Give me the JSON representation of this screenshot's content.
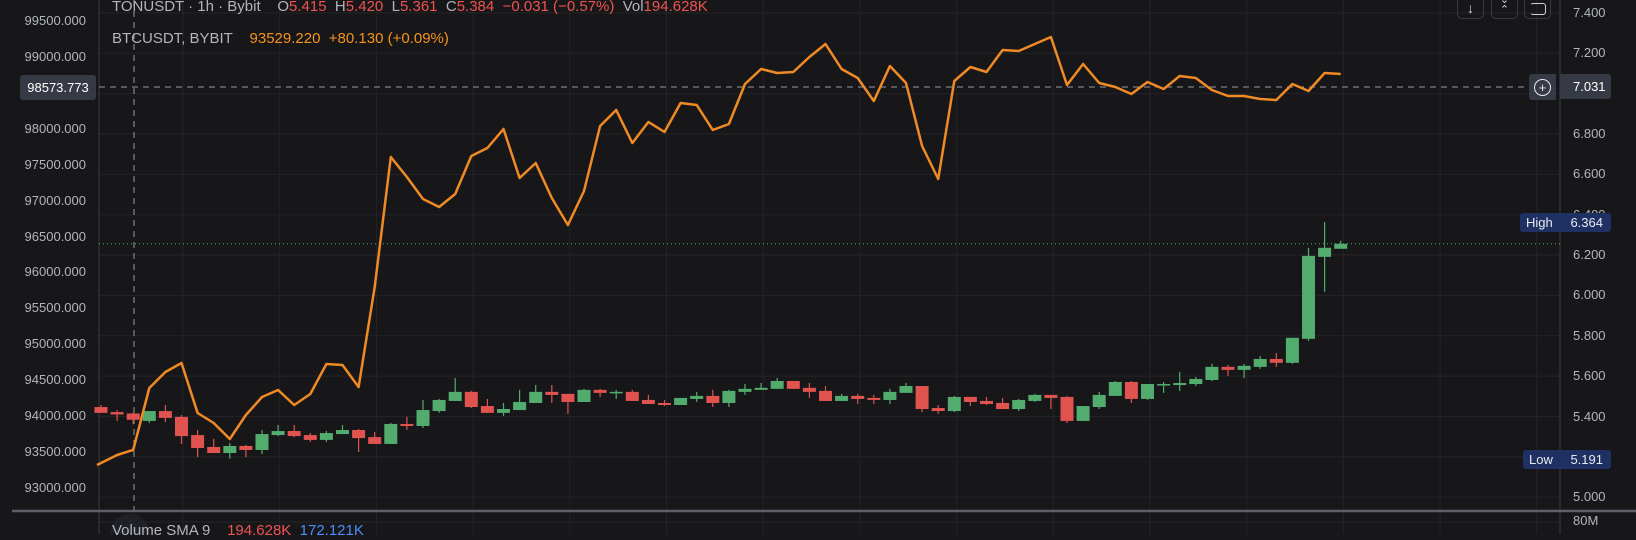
{
  "header": {
    "symbol": "TONUSDT · 1h · Bybit",
    "o_label": "O",
    "o_value": "5.415",
    "h_label": "H",
    "h_value": "5.420",
    "l_label": "L",
    "l_value": "5.361",
    "c_label": "C",
    "c_value": "5.384",
    "change": "−0.031 (−0.57%)",
    "vol_label": "Vol",
    "vol_value": "194.628K",
    "compare_symbol": "BTCUSDT, BYBIT",
    "compare_value": "93529.220",
    "compare_change": "+80.130 (+0.09%)"
  },
  "volume_pane": {
    "label": "Volume SMA 9",
    "volume": "194.628K",
    "sma": "172.121K",
    "axis_label": "80M"
  },
  "crosshair": {
    "left_price": "98573.773",
    "right_price": "7.031"
  },
  "high_marker": {
    "label": "High",
    "value": "6.364"
  },
  "low_marker": {
    "label": "Low",
    "value": "5.191"
  },
  "colors": {
    "up": "#52ac6e",
    "down": "#e0534f",
    "line": "#f08a24",
    "grid": "#242428",
    "bg": "#17171a"
  },
  "toolbar": {
    "icons": [
      "arrow-down-icon",
      "collapse-icon",
      "maximize-icon"
    ]
  },
  "chart_data": {
    "type": "line+candlestick",
    "title": "TONUSDT · 1h · Bybit vs BTCUSDT, BYBIT",
    "left_axis": {
      "series": "BTCUSDT",
      "ticks": [
        "99500.000",
        "99000.000",
        "98000.000",
        "97500.000",
        "97000.000",
        "96500.000",
        "96000.000",
        "95500.000",
        "95000.000",
        "94500.000",
        "94000.000",
        "93500.000",
        "93000.000"
      ],
      "tick_values": [
        99500,
        99000,
        98000,
        97500,
        97000,
        96500,
        96000,
        95500,
        95000,
        94500,
        94000,
        93500,
        93000
      ],
      "range": [
        92820,
        99800
      ]
    },
    "right_axis": {
      "series": "TONUSDT",
      "ticks": [
        "7.400",
        "7.200",
        "6.800",
        "6.600",
        "6.400",
        "6.200",
        "6.000",
        "5.800",
        "5.600",
        "5.400",
        "5.000"
      ],
      "tick_values": [
        7.4,
        7.2,
        6.8,
        6.6,
        6.4,
        6.2,
        6.0,
        5.8,
        5.6,
        5.4,
        5.0
      ],
      "grid_values": [
        7.4,
        7.2,
        7.0,
        6.8,
        6.6,
        6.4,
        6.2,
        6.0,
        5.8,
        5.6,
        5.4,
        5.2,
        5.0
      ],
      "range": [
        4.93,
        7.46
      ]
    },
    "grid": true,
    "last_price": 6.256,
    "btc_line": [
      93320,
      93459,
      93529.22,
      94391,
      94614,
      94739,
      94043,
      93904,
      93681,
      94016,
      94266,
      94364,
      94155,
      94308,
      94725,
      94712,
      94405,
      95797,
      97607,
      97328,
      97022,
      96911,
      97092,
      97621,
      97732,
      97997,
      97315,
      97523,
      97036,
      96660,
      97134,
      98038,
      98261,
      97802,
      98094,
      97955,
      98359,
      98331,
      97983,
      98066,
      98623,
      98832,
      98776,
      98790,
      98999,
      99180,
      98832,
      98707,
      98386,
      98874,
      98637,
      97760,
      97301,
      98665,
      98860,
      98790,
      99096,
      99082,
      99180,
      99277,
      98609,
      98901,
      98637,
      98581,
      98484,
      98651,
      98553,
      98734,
      98707,
      98540,
      98456,
      98456,
      98414,
      98400,
      98623,
      98526,
      98776,
      98762
    ],
    "ton_ohlc": [
      [
        5.447,
        5.457,
        5.418,
        5.418
      ],
      [
        5.422,
        5.432,
        5.378,
        5.41
      ],
      [
        5.415,
        5.42,
        5.361,
        5.384
      ],
      [
        5.378,
        5.427,
        5.368,
        5.427
      ],
      [
        5.427,
        5.457,
        5.373,
        5.393
      ],
      [
        5.398,
        5.407,
        5.264,
        5.303
      ],
      [
        5.308,
        5.333,
        5.199,
        5.244
      ],
      [
        5.249,
        5.289,
        5.219,
        5.219
      ],
      [
        5.219,
        5.269,
        5.191,
        5.254
      ],
      [
        5.254,
        5.259,
        5.199,
        5.234
      ],
      [
        5.234,
        5.333,
        5.214,
        5.313
      ],
      [
        5.308,
        5.358,
        5.303,
        5.328
      ],
      [
        5.328,
        5.358,
        5.298,
        5.303
      ],
      [
        5.308,
        5.318,
        5.274,
        5.284
      ],
      [
        5.284,
        5.328,
        5.274,
        5.318
      ],
      [
        5.313,
        5.358,
        5.313,
        5.333
      ],
      [
        5.333,
        5.338,
        5.224,
        5.293
      ],
      [
        5.298,
        5.323,
        5.264,
        5.264
      ],
      [
        5.264,
        5.368,
        5.264,
        5.363
      ],
      [
        5.363,
        5.398,
        5.333,
        5.353
      ],
      [
        5.353,
        5.482,
        5.343,
        5.432
      ],
      [
        5.427,
        5.487,
        5.418,
        5.482
      ],
      [
        5.477,
        5.591,
        5.477,
        5.522
      ],
      [
        5.522,
        5.527,
        5.442,
        5.447
      ],
      [
        5.452,
        5.487,
        5.418,
        5.418
      ],
      [
        5.418,
        5.467,
        5.403,
        5.437
      ],
      [
        5.432,
        5.532,
        5.432,
        5.472
      ],
      [
        5.467,
        5.556,
        5.467,
        5.522
      ],
      [
        5.522,
        5.556,
        5.467,
        5.507
      ],
      [
        5.512,
        5.512,
        5.413,
        5.472
      ],
      [
        5.472,
        5.537,
        5.472,
        5.532
      ],
      [
        5.532,
        5.537,
        5.497,
        5.517
      ],
      [
        5.517,
        5.532,
        5.487,
        5.522
      ],
      [
        5.522,
        5.532,
        5.477,
        5.477
      ],
      [
        5.482,
        5.507,
        5.462,
        5.462
      ],
      [
        5.467,
        5.482,
        5.452,
        5.457
      ],
      [
        5.457,
        5.492,
        5.457,
        5.492
      ],
      [
        5.487,
        5.522,
        5.472,
        5.502
      ],
      [
        5.502,
        5.532,
        5.447,
        5.467
      ],
      [
        5.467,
        5.532,
        5.447,
        5.527
      ],
      [
        5.522,
        5.561,
        5.507,
        5.537
      ],
      [
        5.532,
        5.566,
        5.532,
        5.542
      ],
      [
        5.537,
        5.591,
        5.537,
        5.576
      ],
      [
        5.576,
        5.576,
        5.537,
        5.537
      ],
      [
        5.542,
        5.566,
        5.492,
        5.522
      ],
      [
        5.527,
        5.551,
        5.477,
        5.477
      ],
      [
        5.477,
        5.512,
        5.477,
        5.502
      ],
      [
        5.502,
        5.512,
        5.462,
        5.487
      ],
      [
        5.492,
        5.507,
        5.462,
        5.482
      ],
      [
        5.482,
        5.537,
        5.462,
        5.522
      ],
      [
        5.517,
        5.566,
        5.517,
        5.551
      ],
      [
        5.551,
        5.551,
        5.422,
        5.437
      ],
      [
        5.442,
        5.457,
        5.413,
        5.427
      ],
      [
        5.427,
        5.502,
        5.422,
        5.497
      ],
      [
        5.497,
        5.497,
        5.452,
        5.472
      ],
      [
        5.477,
        5.497,
        5.457,
        5.462
      ],
      [
        5.467,
        5.492,
        5.437,
        5.437
      ],
      [
        5.437,
        5.487,
        5.427,
        5.482
      ],
      [
        5.477,
        5.512,
        5.472,
        5.507
      ],
      [
        5.507,
        5.507,
        5.437,
        5.492
      ],
      [
        5.497,
        5.502,
        5.368,
        5.378
      ],
      [
        5.378,
        5.452,
        5.378,
        5.452
      ],
      [
        5.447,
        5.522,
        5.437,
        5.507
      ],
      [
        5.502,
        5.576,
        5.502,
        5.571
      ],
      [
        5.571,
        5.576,
        5.467,
        5.487
      ],
      [
        5.487,
        5.561,
        5.482,
        5.561
      ],
      [
        5.556,
        5.571,
        5.517,
        5.561
      ],
      [
        5.556,
        5.621,
        5.527,
        5.566
      ],
      [
        5.561,
        5.596,
        5.551,
        5.586
      ],
      [
        5.581,
        5.661,
        5.576,
        5.646
      ],
      [
        5.646,
        5.656,
        5.601,
        5.631
      ],
      [
        5.631,
        5.661,
        5.591,
        5.651
      ],
      [
        5.646,
        5.7,
        5.636,
        5.685
      ],
      [
        5.685,
        5.715,
        5.646,
        5.666
      ],
      [
        5.666,
        5.79,
        5.661,
        5.79
      ],
      [
        5.785,
        6.236,
        5.775,
        6.196
      ],
      [
        6.191,
        6.364,
        6.018,
        6.236
      ],
      [
        6.231,
        6.271,
        6.231,
        6.256
      ]
    ]
  }
}
